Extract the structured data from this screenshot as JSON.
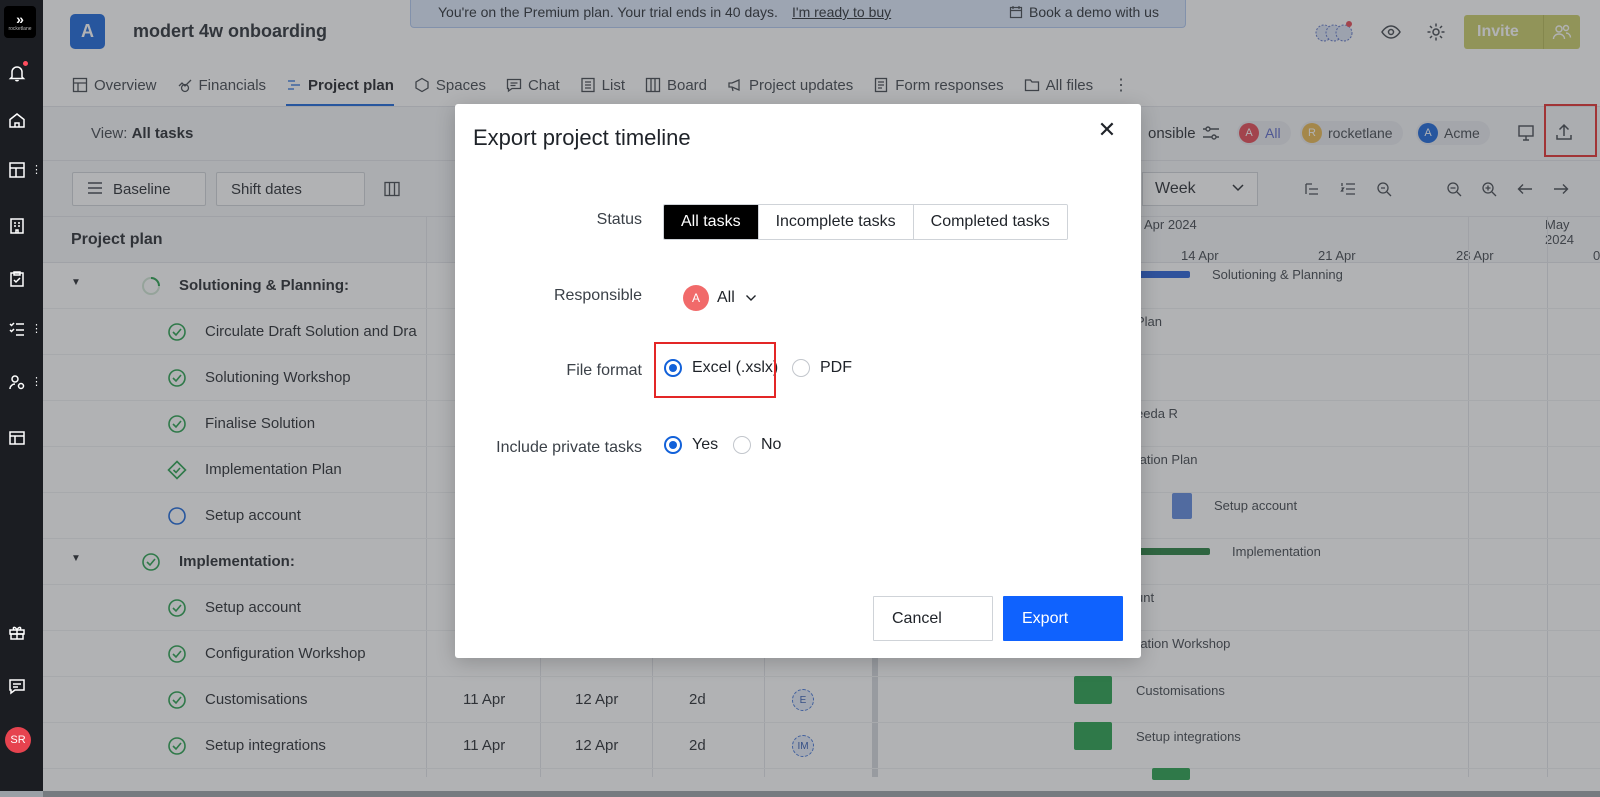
{
  "app": {
    "brand_logo_text": "rocketlane"
  },
  "sidebar": {
    "icons": [
      "bell-icon",
      "home-icon",
      "dashboard-icon",
      "building-icon",
      "clipboard-icon",
      "checklist-icon",
      "user-settings-icon",
      "layout-icon",
      "gift-icon",
      "chat-icon"
    ],
    "user_initials": "SR"
  },
  "header": {
    "project_initial": "A",
    "project_title": "modert 4w onboarding",
    "banner": {
      "text": "You're on the Premium plan. Your trial ends in 40 days.",
      "link": "I'm ready to buy",
      "demo": "Book a demo with us"
    },
    "invite_label": "Invite"
  },
  "tabs": [
    {
      "label": "Overview",
      "icon": "overview-icon"
    },
    {
      "label": "Financials",
      "icon": "financials-icon"
    },
    {
      "label": "Project plan",
      "icon": "project-plan-icon",
      "active": true
    },
    {
      "label": "Spaces",
      "icon": "spaces-icon"
    },
    {
      "label": "Chat",
      "icon": "chat-icon"
    },
    {
      "label": "List",
      "icon": "list-icon"
    },
    {
      "label": "Board",
      "icon": "board-icon"
    },
    {
      "label": "Project updates",
      "icon": "megaphone-icon"
    },
    {
      "label": "Form responses",
      "icon": "form-icon"
    },
    {
      "label": "All files",
      "icon": "folder-icon"
    }
  ],
  "viewbar": {
    "view_prefix": "View:",
    "view_value": "All tasks",
    "responsible_label": "onsible",
    "chips": [
      {
        "initial": "A",
        "label": "All",
        "color": "#e6434f"
      },
      {
        "initial": "R",
        "label": "rocketlane",
        "color": "#e8b64a"
      },
      {
        "initial": "A",
        "label": "Acme",
        "color": "#1261d9"
      }
    ]
  },
  "toolbar": {
    "baseline": "Baseline",
    "shift_dates": "Shift dates",
    "week": "Week"
  },
  "timeline": {
    "month_labels": [
      "Apr 2024",
      "May 2024"
    ],
    "week_labels": [
      "14 Apr",
      "21 Apr",
      "28 Apr",
      "0"
    ],
    "bar_labels": [
      "Solutioning & Planning",
      "Plan",
      "eeda R",
      "tation Plan",
      "Setup account",
      "Implementation",
      "unt",
      "ration Workshop",
      "Customisations",
      "Setup integrations"
    ]
  },
  "grid": {
    "header": "Project plan",
    "rows": [
      {
        "name": "Solutioning & Planning:",
        "group": true
      },
      {
        "name": "Circulate Draft Solution and Dra"
      },
      {
        "name": "Solutioning Workshop"
      },
      {
        "name": "Finalise Solution"
      },
      {
        "name": "Implementation Plan",
        "milestone": true
      },
      {
        "name": "Setup account",
        "open": true
      },
      {
        "name": "Implementation:",
        "group": true
      },
      {
        "name": "Setup account"
      },
      {
        "name": "Configuration Workshop",
        "start": "",
        "end": "",
        "duration": ""
      },
      {
        "name": "Customisations",
        "start": "11 Apr",
        "end": "12 Apr",
        "duration": "2d",
        "assignee": "E"
      },
      {
        "name": "Setup integrations",
        "start": "11 Apr",
        "end": "12 Apr",
        "duration": "2d",
        "assignee": "IM"
      }
    ]
  },
  "modal": {
    "title": "Export project timeline",
    "status_label": "Status",
    "status_options": [
      "All tasks",
      "Incomplete tasks",
      "Completed tasks"
    ],
    "status_selected": "All tasks",
    "responsible_label": "Responsible",
    "responsible_initial": "A",
    "responsible_value": "All",
    "file_format_label": "File format",
    "format_excel": "Excel (.xslx)",
    "format_pdf": "PDF",
    "format_selected": "Excel (.xslx)",
    "private_label": "Include private tasks",
    "private_yes": "Yes",
    "private_no": "No",
    "private_selected": "Yes",
    "cancel": "Cancel",
    "export": "Export"
  },
  "colors": {
    "accent": "#0f62fe",
    "highlight": "#e32626",
    "gantt_green": "#1f9d48",
    "gantt_blue": "#1f5ad6"
  }
}
